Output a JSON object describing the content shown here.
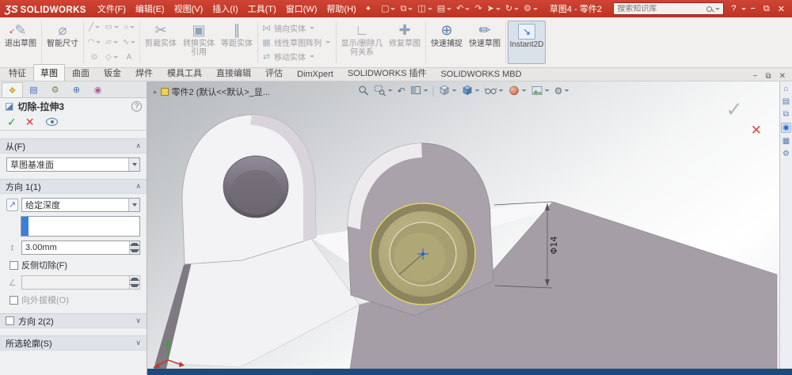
{
  "title_bar": {
    "logo_ds": "ƷS",
    "logo_text": "SOLIDWORKS",
    "menus": [
      "文件(F)",
      "编辑(E)",
      "视图(V)",
      "插入(I)",
      "工具(T)",
      "窗口(W)",
      "帮助(H)"
    ],
    "doc_title": "草图4 - 零件2",
    "search_placeholder": "搜索知识库"
  },
  "ribbon": {
    "exit_sketch": "退出草图",
    "smart_dimension": "智能尺寸",
    "trim_entities": "剪裁实体",
    "convert_entities": "转换实体引用",
    "offset_entities": "等距实体",
    "mirror_entities": "镜向实体",
    "linear_pattern": "线性草图阵列",
    "move_entities": "移动实体",
    "display_relations": "显示/删除几何关系",
    "repair_sketch": "修复草图",
    "quick_snaps": "快速捕捉",
    "rapid_sketch": "快速草图",
    "instant2d": "Instant2D"
  },
  "command_tabs": [
    "特征",
    "草图",
    "曲面",
    "钣金",
    "焊件",
    "模具工具",
    "直接编辑",
    "评估",
    "DimXpert",
    "SOLIDWORKS 插件",
    "SOLIDWORKS MBD"
  ],
  "property_manager": {
    "title": "切除-拉伸3",
    "help": "?",
    "from": {
      "header": "从(F)",
      "value": "草图基准面"
    },
    "direction1": {
      "header": "方向 1(1)",
      "end_condition": "给定深度",
      "depth_value": "3.00mm",
      "flip_side_label": "反侧切除(F)",
      "draft_outward_label": "向外拔模(O)"
    },
    "direction2": {
      "header": "方向 2(2)"
    },
    "selected_contours": {
      "header": "所选轮廓(S)"
    }
  },
  "graphics": {
    "breadcrumb": "零件2 (默认<<默认>_显...",
    "dimension_label": "Φ14"
  },
  "glyphs": {
    "pin": "✦",
    "qa": [
      "▢",
      "⧉",
      "◫",
      "▤",
      "↶",
      "↷",
      "➤",
      "↻",
      "⚙"
    ],
    "help": "?",
    "minimize": "−",
    "restore": "⧉",
    "close": "✕",
    "exit_pencil": "✎",
    "exit_arrow": "↙",
    "smart_dim": "⌀",
    "tools": [
      "╱",
      "▭",
      "○",
      "◠",
      "▱",
      "∿",
      "⊙",
      "◇",
      "A"
    ],
    "trim": "✂",
    "convert": "▣",
    "offset": "∥",
    "mirror": "⋈",
    "linear": "▦",
    "move": "⇄",
    "relations": "∟",
    "repair": "✚",
    "snaps": "⊕",
    "rapid": "✏",
    "instant2d": "↘",
    "doc_min": "−",
    "doc_restore": "⧉",
    "doc_close": "✕",
    "pm_tabs": [
      "❖",
      "▤",
      "⚙",
      "⊕",
      "◉"
    ],
    "feature": "◪",
    "ok": "✓",
    "cancel": "✕",
    "chev_up": "∧",
    "chev_down": "∨",
    "dir": "↗",
    "depth": "↕",
    "draft": "∠",
    "crumb": "▸",
    "confirm_ok": "✓",
    "confirm_cancel": "✕",
    "prev_view": "↶",
    "settings": "⚙",
    "tp": [
      "⌂",
      "▤",
      "⧉",
      "◉",
      "▦",
      "⚙"
    ]
  }
}
